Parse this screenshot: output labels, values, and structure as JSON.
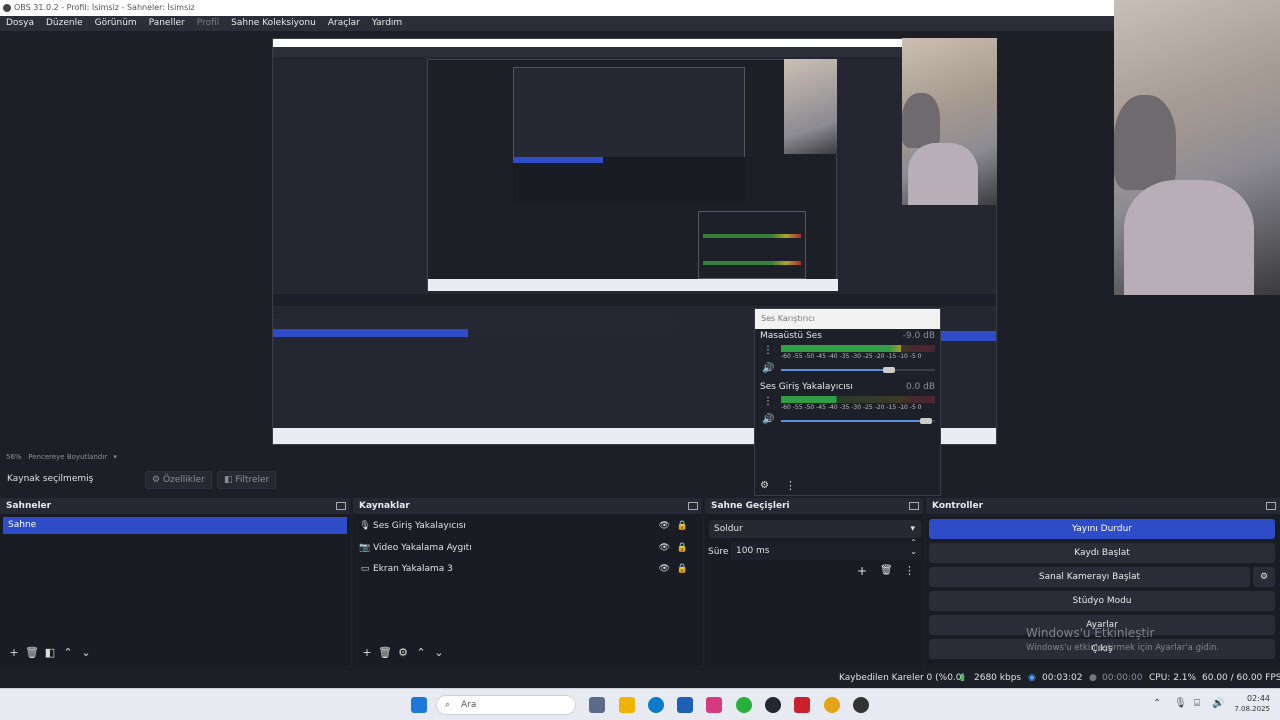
{
  "window": {
    "title": "OBS 31.0.2 - Profil: İsimsiz - Sahneler: İsimsiz"
  },
  "menu": [
    "Dosya",
    "Düzenle",
    "Görünüm",
    "Paneller",
    "Profil",
    "Sahne Koleksiyonu",
    "Araçlar",
    "Yardım"
  ],
  "preview": {
    "zoom": "56%",
    "resize_label": "Pencereye Boyutlandır"
  },
  "source_bar": {
    "label": "Kaynak seçilmemiş",
    "properties": "Özellikler",
    "filters": "Filtreler"
  },
  "scenes": {
    "title": "Sahneler",
    "items": [
      "Sahne"
    ],
    "selected": 0
  },
  "sources": {
    "title": "Kaynaklar",
    "items": [
      {
        "icon": "microphone-icon",
        "label": "Ses Giriş Yakalayıcısı"
      },
      {
        "icon": "camera-icon",
        "label": "Video Yakalama Aygıtı"
      },
      {
        "icon": "monitor-icon",
        "label": "Ekran Yakalama 3"
      }
    ]
  },
  "transitions": {
    "title": "Sahne Geçişleri",
    "selected": "Soldur",
    "duration_label": "Süre",
    "duration_value": "100 ms"
  },
  "controls": {
    "title": "Kontroller",
    "stream": "Yayını Durdur",
    "record": "Kaydı Başlat",
    "virtual_cam": "Sanal Kamerayı Başlat",
    "studio": "Stüdyo Modu",
    "settings": "Ayarlar",
    "exit": "Çıkış"
  },
  "mixer": {
    "title": "Ses Karıştırıcı",
    "ticks": "-60 -55 -50 -45 -40 -35 -30 -25 -20 -15 -10 -5 0",
    "channels": [
      {
        "name": "Masaüstü Ses",
        "db": "-9.0 dB",
        "level": 0.78,
        "volume": 0.74
      },
      {
        "name": "Ses Giriş Yakalayıcısı",
        "db": "0.0 dB",
        "level": 0.36,
        "volume": 0.98
      }
    ]
  },
  "status": {
    "dropped": "Kaybedilen Kareler 0 (%0.0)",
    "bitrate": "2680 kbps",
    "stream_time": "00:03:02",
    "rec_time": "00:00:00",
    "cpu": "CPU: 2.1%",
    "fps": "60.00 / 60.00 FPS"
  },
  "watermark": {
    "title": "Windows'u Etkinleştir",
    "subtitle": "Windows'u etkinleştirmek için Ayarlar'a gidin."
  },
  "taskbar": {
    "search_placeholder": "Ara",
    "time": "02:44",
    "date": "7.08.2025"
  },
  "colors": {
    "accent": "#2e4cc7",
    "panel": "#1a1c24",
    "header": "#262933"
  }
}
